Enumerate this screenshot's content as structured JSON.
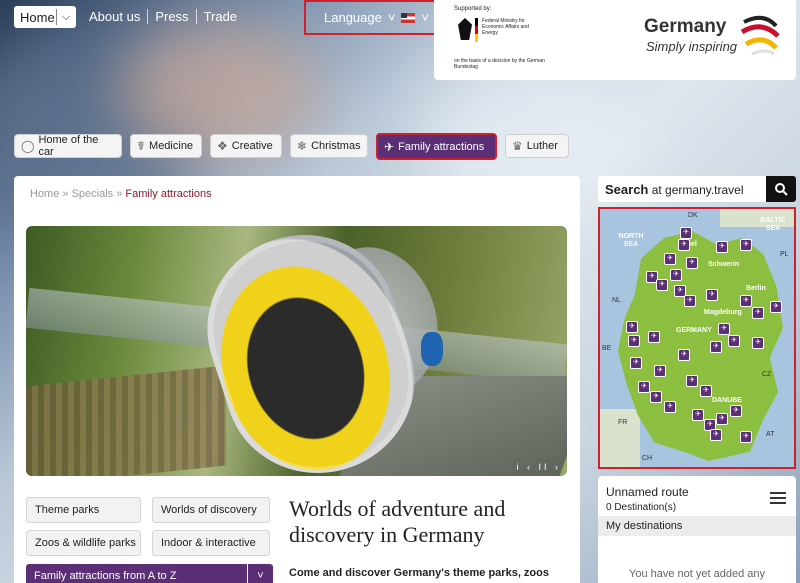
{
  "topbar": {
    "home_label": "Home",
    "links": [
      "About us",
      "Press",
      "Trade"
    ],
    "language_label": "Language"
  },
  "sponsor": {
    "supported_by": "Supported by:",
    "ministry": "Federal Ministry for Economic Affairs and Energy",
    "basis": "on the basis of a decision by the German Bundestag",
    "brand": "Germany",
    "tagline": "Simply inspiring"
  },
  "categories": [
    {
      "label": "Home of the car",
      "icon": "steering-wheel-icon"
    },
    {
      "label": "Medicine",
      "icon": "caduceus-icon"
    },
    {
      "label": "Creative",
      "icon": "creative-icon"
    },
    {
      "label": "Christmas",
      "icon": "christmas-icon"
    },
    {
      "label": "Family attractions",
      "icon": "family-icon"
    },
    {
      "label": "Luther",
      "icon": "luther-icon"
    }
  ],
  "breadcrumb": {
    "home": "Home",
    "specials": "Specials",
    "current": "Family attractions",
    "separator": "»"
  },
  "hero": {
    "controls": "i ‹ II ›"
  },
  "subcategories": [
    "Theme parks",
    "Worlds of discovery",
    "Zoos & wildlife parks",
    "Indoor & interactive"
  ],
  "az_button": "Family attractions from A to Z",
  "article": {
    "title": "Worlds of adventure and discovery in Germany",
    "intro": "Come and discover Germany's theme parks, zoos and"
  },
  "search": {
    "bold": "Search",
    "rest": " at germany.travel"
  },
  "map": {
    "labels": {
      "dk": "DK",
      "north_sea": "NORTH SEA",
      "baltic_sea": "BALTIC SEA",
      "kiel": "Kiel",
      "schwerin": "Schwerin",
      "pl": "PL",
      "nl": "NL",
      "berlin": "Berlin",
      "magdeburg": "Magdeburg",
      "germany": "GERMANY",
      "be": "BE",
      "cz": "CZ",
      "danube": "DANUBE",
      "fr": "FR",
      "at": "AT",
      "ch": "CH"
    }
  },
  "route": {
    "title": "Unnamed route",
    "count": "0 Destination(s)",
    "my_destinations": "My destinations",
    "empty": "You have not yet added any"
  }
}
